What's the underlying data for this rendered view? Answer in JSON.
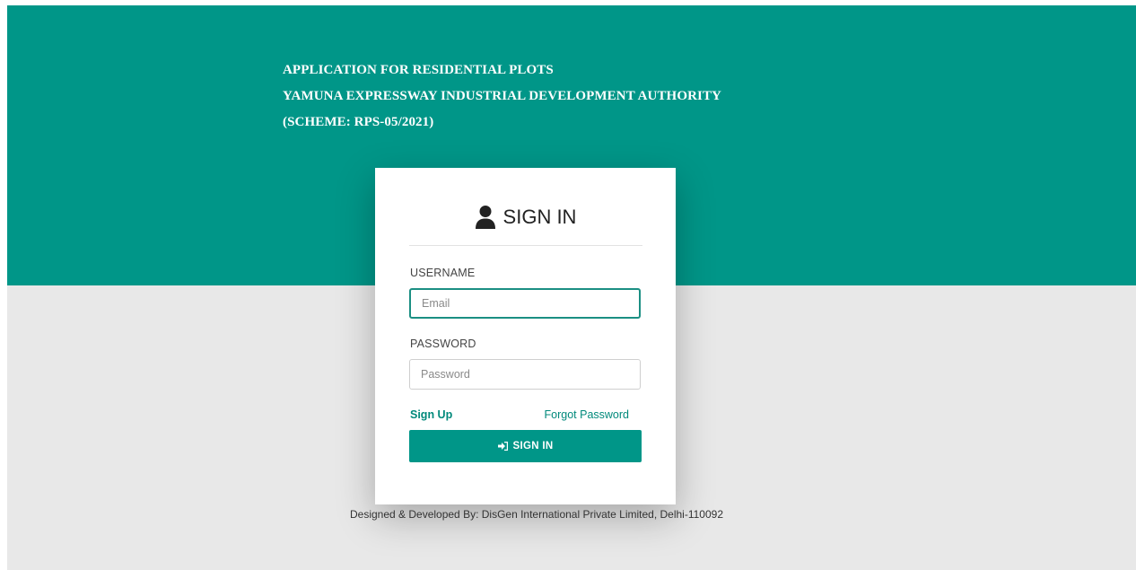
{
  "header": {
    "line1": "APPLICATION FOR RESIDENTIAL PLOTS",
    "line2": "YAMUNA EXPRESSWAY INDUSTRIAL DEVELOPMENT AUTHORITY",
    "line3": "(SCHEME: RPS-05/2021)"
  },
  "login": {
    "title": "SIGN IN",
    "username_label": "USERNAME",
    "username_placeholder": "Email",
    "username_value": "",
    "password_label": "PASSWORD",
    "password_placeholder": "Password",
    "password_value": "",
    "signup_link": "Sign Up",
    "forgot_link": "Forgot Password",
    "submit_label": "SIGN IN"
  },
  "footer": {
    "credit": "Designed & Developed By: DisGen International Private Limited, Delhi-110092"
  },
  "colors": {
    "brand": "#009688",
    "background": "#e8e8e8",
    "card": "#ffffff"
  },
  "icons": {
    "title_icon": "user-icon",
    "button_icon": "sign-in-icon"
  }
}
